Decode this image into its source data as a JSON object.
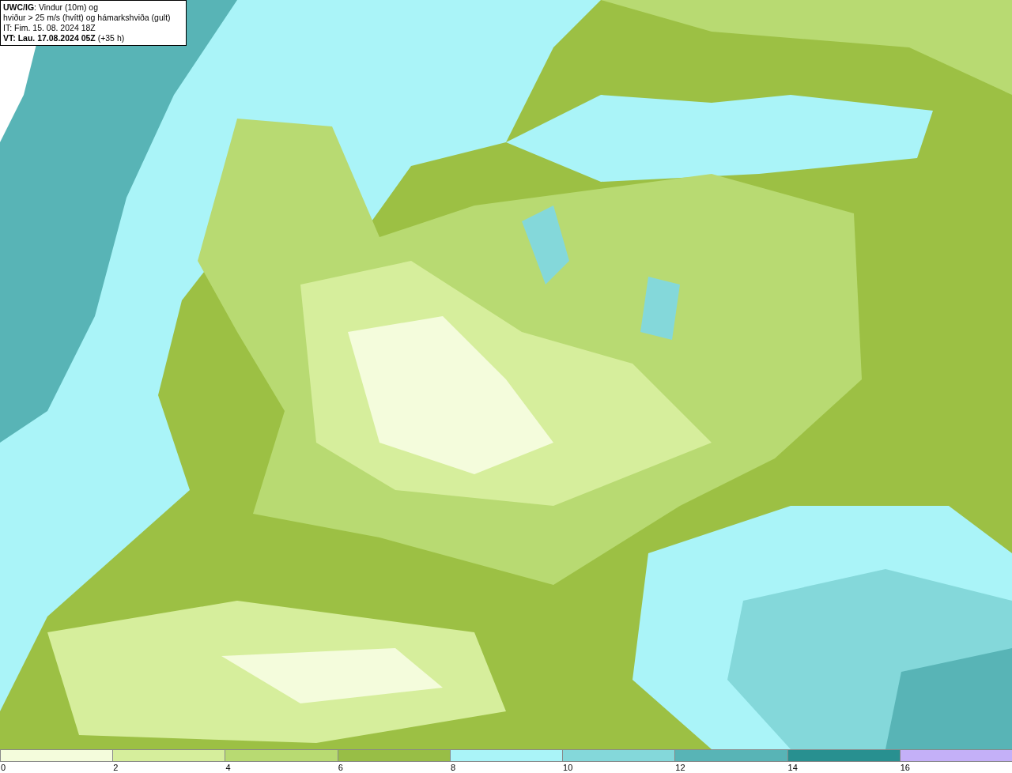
{
  "legend_box": {
    "lines": [
      "**UWC/IG**: Vindur (10m) og",
      "hviður > 25 m/s (hvítt) og hámarkshviða (gult)",
      "IT: Fim. 15. 08. 2024 18Z",
      "**VT: Lau. 17.08.2024 05Z** (+35 h)"
    ]
  },
  "color_scale": [
    {
      "label": "0",
      "color": "#f4fcdc"
    },
    {
      "label": "2",
      "color": "#d6ee9c"
    },
    {
      "label": "4",
      "color": "#b8da72"
    },
    {
      "label": "6",
      "color": "#98be46"
    },
    {
      "label": "8",
      "color": "#aaf4f8"
    },
    {
      "label": "10",
      "color": "#84d8da"
    },
    {
      "label": "12",
      "color": "#58b4b6"
    },
    {
      "label": "14",
      "color": "#289090"
    },
    {
      "label": "16",
      "color": "#c4b0f8"
    }
  ]
}
